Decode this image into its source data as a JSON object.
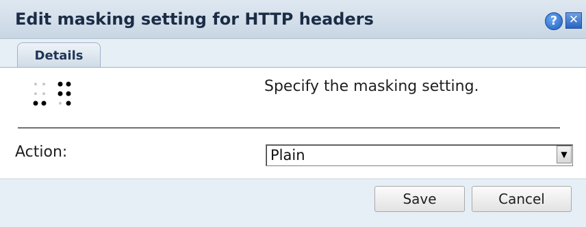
{
  "dialog": {
    "title": "Edit masking setting for HTTP headers",
    "help_glyph": "?",
    "close_glyph": "✕",
    "icons": {
      "help": "help-icon",
      "close": "close-icon",
      "masking": "masking-dots-icon"
    }
  },
  "tabs": [
    {
      "label": "Details",
      "selected": true
    }
  ],
  "form": {
    "instruction": "Specify the masking setting.",
    "action_label": "Action:",
    "action_value": "Plain",
    "action_arrow": "▼"
  },
  "buttons": {
    "save": "Save",
    "cancel": "Cancel"
  }
}
